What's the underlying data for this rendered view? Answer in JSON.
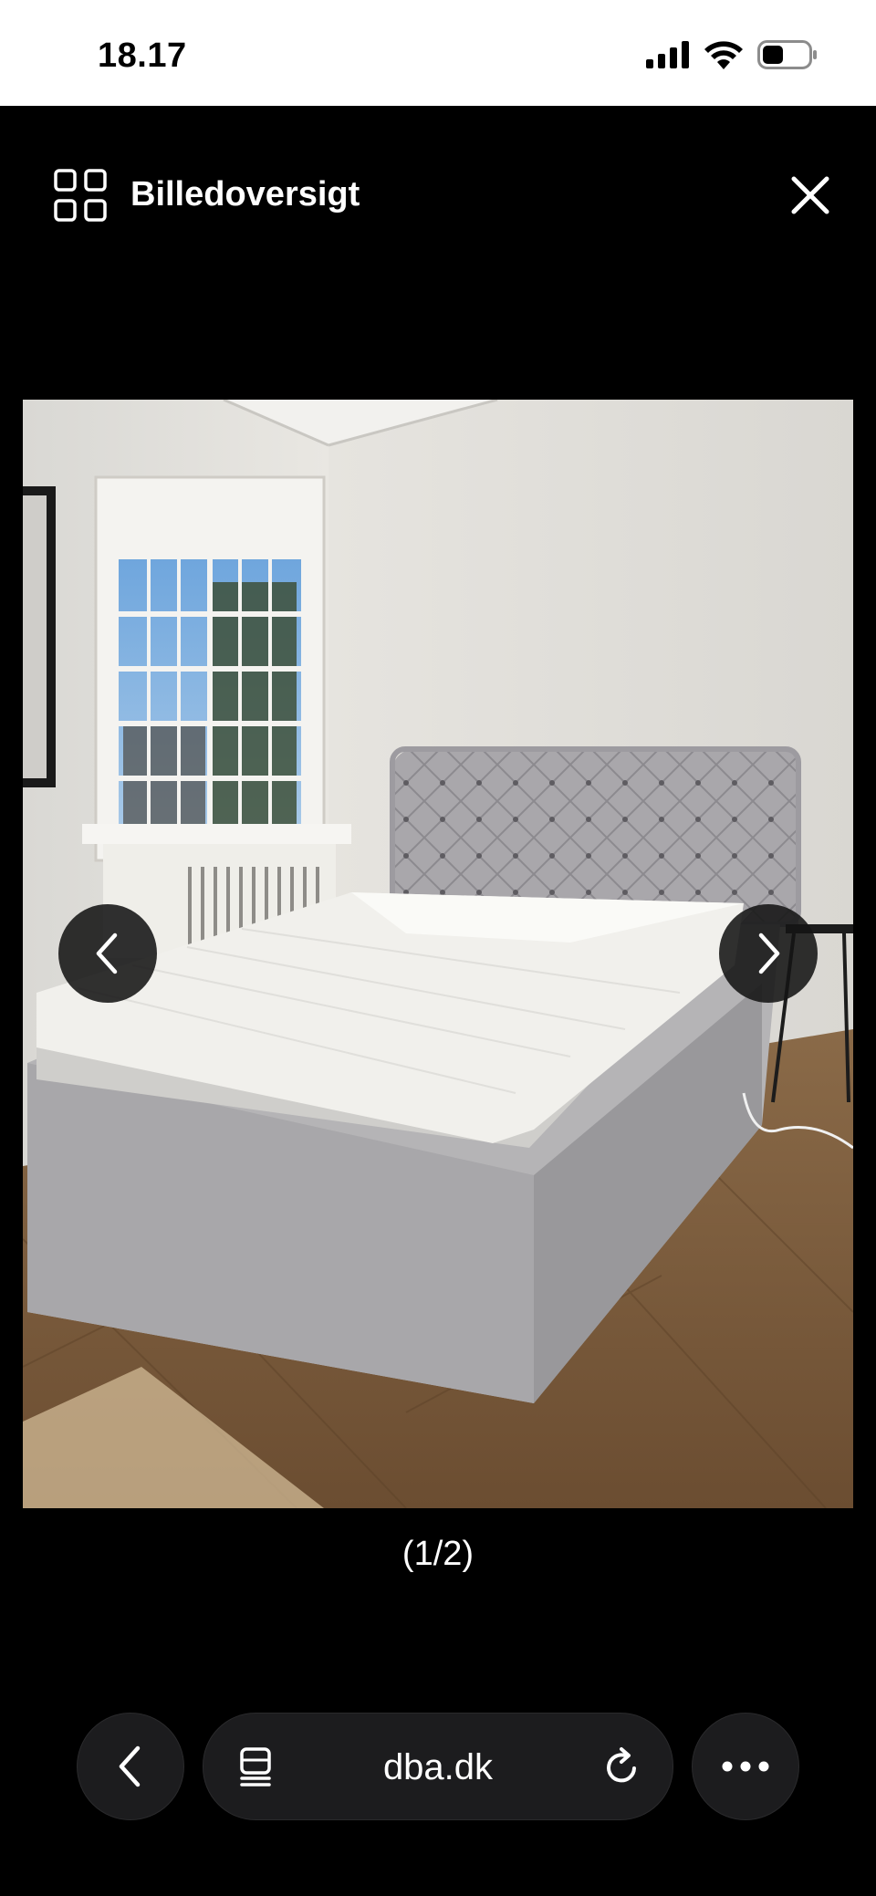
{
  "status_bar": {
    "time": "18.17",
    "icons": [
      "signal-icon",
      "wifi-icon",
      "battery-icon"
    ]
  },
  "viewer": {
    "title": "Billedoversigt",
    "grid_icon": "grid-icon",
    "close_icon": "close-icon",
    "counter": "(1/2)",
    "prev_icon": "chevron-left-icon",
    "next_icon": "chevron-right-icon",
    "image_subject": "upholstered-bed"
  },
  "browser": {
    "url": "dba.dk",
    "back_icon": "chevron-left-icon",
    "tabs_icon": "tabs-icon",
    "reload_icon": "reload-icon",
    "more_icon": "more-icon"
  },
  "colors": {
    "background": "#000000",
    "status_bar": "#ffffff",
    "control_bg": "#1c1c1e"
  }
}
